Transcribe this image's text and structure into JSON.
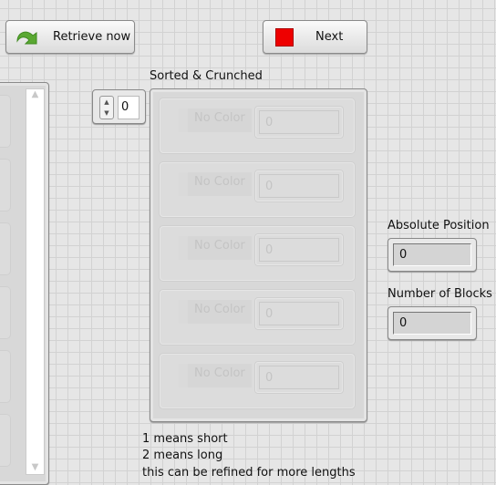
{
  "toolbar": {
    "retrieve_label": "Retrieve now",
    "next_label": "Next",
    "next_color": "#ee0000",
    "retrieve_icon": "green-curved-arrow"
  },
  "array": {
    "label": "Sorted & Crunched",
    "index": "0",
    "elements": [
      {
        "color": "No Color",
        "value": "0"
      },
      {
        "color": "No Color",
        "value": "0"
      },
      {
        "color": "No Color",
        "value": "0"
      },
      {
        "color": "No Color",
        "value": "0"
      },
      {
        "color": "No Color",
        "value": "0"
      }
    ]
  },
  "indicators": {
    "absolute_position": {
      "label": "Absolute Position",
      "value": "0"
    },
    "number_of_blocks": {
      "label": "Number of Blocks",
      "value": "0"
    }
  },
  "note": {
    "line1": "1 means short",
    "line2": "2 means long",
    "line3": "this can be refined for more lengths"
  }
}
